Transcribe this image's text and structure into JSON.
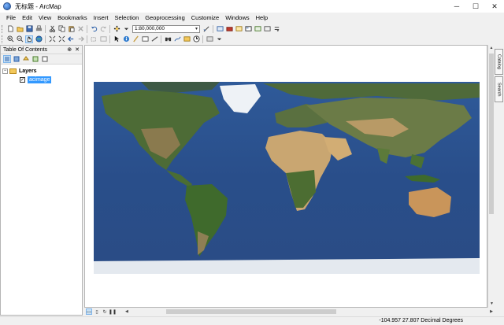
{
  "window": {
    "title": "无标题 - ArcMap",
    "controls": {
      "minimize": "─",
      "maximize": "☐",
      "close": "✕"
    }
  },
  "menu": [
    "File",
    "Edit",
    "View",
    "Bookmarks",
    "Insert",
    "Selection",
    "Geoprocessing",
    "Customize",
    "Windows",
    "Help"
  ],
  "toolbar": {
    "scale_value": "1:80,000,000"
  },
  "toc": {
    "title": "Table Of Contents",
    "pin_label": "⊕",
    "close_label": "✕",
    "root_label": "Layers",
    "expander_symbol": "−",
    "layer": {
      "name": "acimage",
      "checked": "✓"
    }
  },
  "side_tabs": [
    "Catalog",
    "Search"
  ],
  "status": {
    "coordinates": "-104.957  27.807 Decimal Degrees"
  },
  "colors": {
    "selection": "#3399ff",
    "ocean": "#2b4f8c",
    "land_green": "#4c6b34",
    "desert": "#c9a671",
    "ice": "#e8eef4"
  }
}
